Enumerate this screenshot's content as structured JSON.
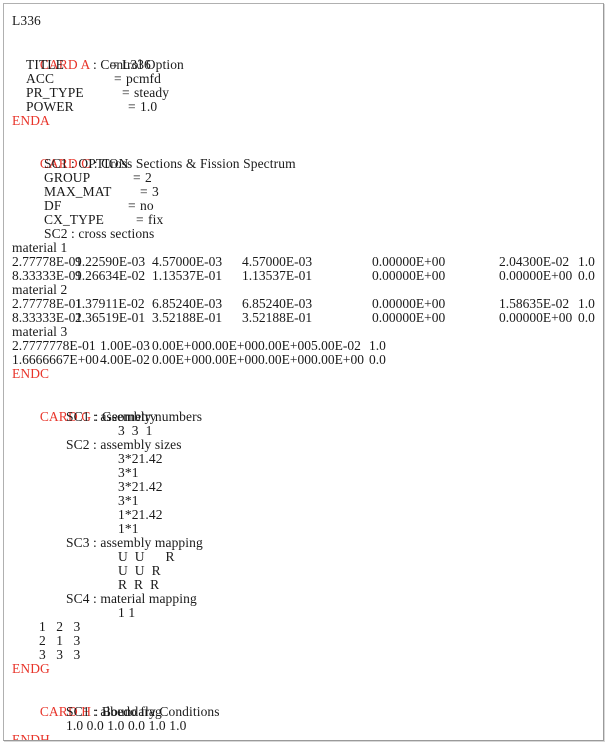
{
  "document": {
    "title": "L336",
    "colors": {
      "card_keyword": "#e8342a",
      "body_text": "#1a1a1a",
      "border": "#b0b0b0",
      "background": "#ffffff"
    }
  },
  "header": {
    "title_line": "L336"
  },
  "card_a": {
    "keyword": "CARD A",
    "title": " : Control Option",
    "entries": [
      {
        "name": "TITLE",
        "eq": "=",
        "value": "L336"
      },
      {
        "name": "ACC",
        "eq": "=",
        "value": "pcmfd"
      },
      {
        "name": "PR_TYPE",
        "eq": "=",
        "value": "steady"
      },
      {
        "name": "POWER",
        "eq": "=",
        "value": "1.0"
      }
    ],
    "end": "ENDA"
  },
  "card_c": {
    "keyword": "CARD C",
    "title": " : Cross Sections & Fission Spectrum",
    "sc1_label": "SC1 : OPTION",
    "entries": [
      {
        "name": "GROUP",
        "eq": "=",
        "value": "2"
      },
      {
        "name": "MAX_MAT",
        "eq": "=",
        "value": "3"
      },
      {
        "name": "DF",
        "eq": "=",
        "value": "no"
      },
      {
        "name": "CX_TYPE",
        "eq": "=",
        "value": "fix"
      }
    ],
    "sc2_label": "SC2 : cross sections",
    "materials": [
      {
        "label": "material 1",
        "rows": [
          {
            "c1": "2.77778E-01",
            "c2": "9.22590E-03",
            "c3": "4.57000E-03",
            "c4": "4.57000E-03",
            "c5": "0.00000E+00",
            "c6": "2.04300E-02",
            "c7": "1.0"
          },
          {
            "c1": "8.33333E-01",
            "c2": "9.26634E-02",
            "c3": "1.13537E-01",
            "c4": "1.13537E-01",
            "c5": "0.00000E+00",
            "c6": "0.00000E+00",
            "c7": "0.0"
          }
        ]
      },
      {
        "label": "material 2",
        "rows": [
          {
            "c1": "2.77778E-01",
            "c2": "1.37911E-02",
            "c3": "6.85240E-03",
            "c4": "6.85240E-03",
            "c5": "0.00000E+00",
            "c6": "1.58635E-02",
            "c7": "1.0"
          },
          {
            "c1": "8.33333E-01",
            "c2": "2.36519E-01",
            "c3": "3.52188E-01",
            "c4": "3.52188E-01",
            "c5": "0.00000E+00",
            "c6": "0.00000E+00",
            "c7": "0.0"
          }
        ]
      },
      {
        "label": "material 3",
        "rows": [
          {
            "c1": "2.7777778E-01",
            "c2": "1.00E-03",
            "c3": "0.00E+00",
            "c4": "0.00E+00",
            "c5": "0.00E+00",
            "c6": "5.00E-02",
            "c7": "1.0"
          },
          {
            "c1": "1.6666667E+00",
            "c2": "4.00E-02",
            "c3": "0.00E+00",
            "c4": "0.00E+00",
            "c5": "0.00E+00",
            "c6": "0.00E+00",
            "c7": "0.0"
          }
        ]
      }
    ],
    "end": "ENDC"
  },
  "card_g": {
    "keyword": "CARD G",
    "title": " : Geometry",
    "sc1_label": "SC1 : assembly numbers",
    "sc1_values": "3  3  1",
    "sc2_label": "SC2 : assembly sizes",
    "sc2_values": [
      "3*21.42",
      "3*1",
      "3*21.42",
      "3*1",
      "1*21.42",
      "1*1"
    ],
    "sc3_label": "SC3 : assembly mapping",
    "sc3_rows": [
      "U  U      R",
      "U  U  R",
      "R  R  R"
    ],
    "sc4_label": "SC4 : material mapping",
    "sc4_values": "1 1",
    "material_map_rows": [
      "1   2   3",
      "2   1   3",
      "3   3   3"
    ],
    "end": "ENDG"
  },
  "card_h": {
    "keyword": "CARD H",
    "title": " : Boundary Conditions",
    "sc1_label": "SC1 : albedo flag",
    "sc1_values": "1.0 0.0 1.0 0.0 1.0 1.0",
    "end": "ENDH"
  }
}
